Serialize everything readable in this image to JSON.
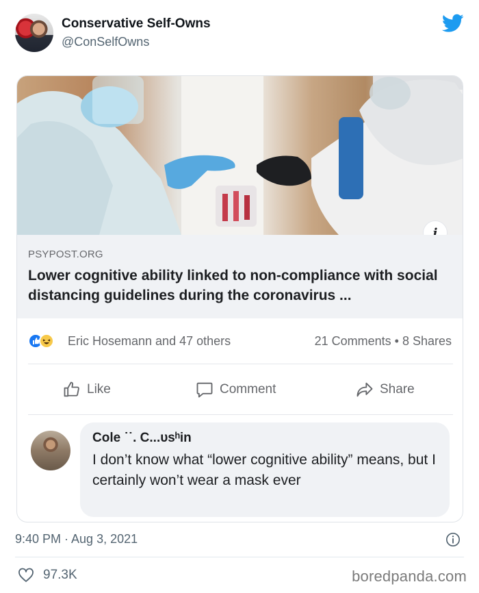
{
  "tweet": {
    "display_name": "Conservative Self-Owns",
    "handle": "@ConSelfOwns",
    "brand_color": "#1d9bf0",
    "timestamp": "9:40 PM · Aug 3, 2021",
    "likes": "97.3K"
  },
  "facebook_post": {
    "link": {
      "domain": "PSYPOST.ORG",
      "title": "Lower cognitive ability linked to non-compliance with social distancing guidelines during the coronavirus ...",
      "info_icon": "info-icon"
    },
    "reactions": {
      "names": "Eric Hosemann and 47 others",
      "counts": "21 Comments • 8 Shares",
      "icons": [
        "like-reaction-icon",
        "haha-reaction-icon"
      ]
    },
    "actions": [
      {
        "label": "Like",
        "icon": "thumbs-up-icon"
      },
      {
        "label": "Comment",
        "icon": "speech-bubble-icon"
      },
      {
        "label": "Share",
        "icon": "share-arrow-icon"
      }
    ],
    "comment": {
      "author": "Cole ˙˙. C...ᴜsʰin",
      "text": "I don’t know what “lower cognitive ability” means, but I certainly won’t wear a mask ever"
    }
  },
  "watermark": "boredpanda.com"
}
